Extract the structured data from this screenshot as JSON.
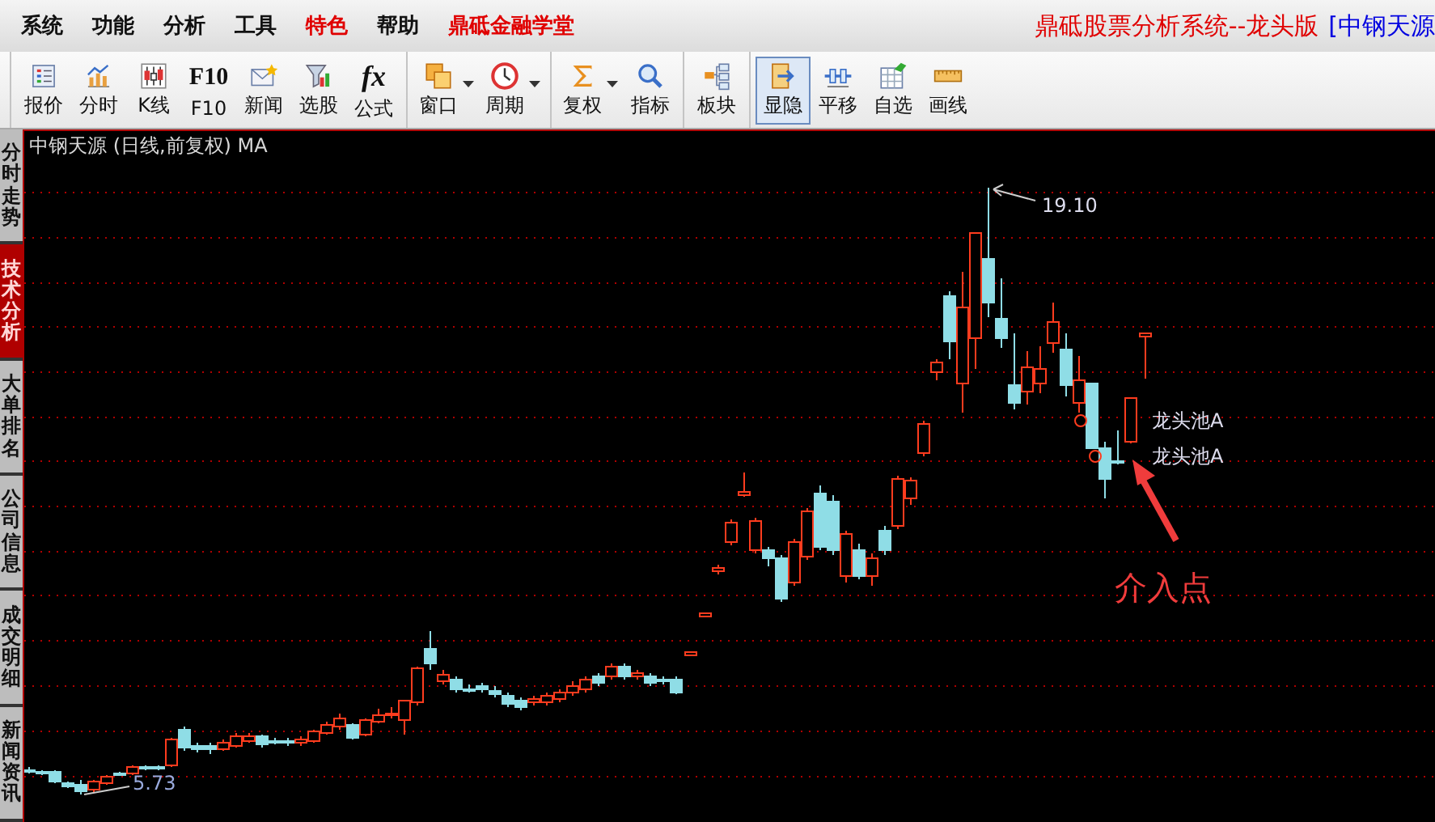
{
  "menu": [
    {
      "label": "系统",
      "highlight": false
    },
    {
      "label": "功能",
      "highlight": false
    },
    {
      "label": "分析",
      "highlight": false
    },
    {
      "label": "工具",
      "highlight": false
    },
    {
      "label": "特色",
      "highlight": true
    },
    {
      "label": "帮助",
      "highlight": false
    },
    {
      "label": "鼎砥金融学堂",
      "highlight": true
    }
  ],
  "app_title": "鼎砥股票分析系统--龙头版",
  "stock_name": "[中钢天源",
  "toolbar": {
    "groups": [
      [
        {
          "label": "报价",
          "dropdown": false,
          "selected": false
        },
        {
          "label": "分时",
          "dropdown": false,
          "selected": false
        },
        {
          "label": "K线",
          "dropdown": false,
          "selected": false
        },
        {
          "label": "F10",
          "icon_text": "F10",
          "dropdown": false,
          "selected": false
        },
        {
          "label": "新闻",
          "dropdown": false,
          "selected": false
        },
        {
          "label": "选股",
          "dropdown": false,
          "selected": false
        },
        {
          "label": "公式",
          "icon_text": "fx",
          "dropdown": false,
          "selected": false
        }
      ],
      [
        {
          "label": "窗口",
          "dropdown": true,
          "selected": false
        },
        {
          "label": "周期",
          "dropdown": true,
          "selected": false
        }
      ],
      [
        {
          "label": "复权",
          "dropdown": true,
          "selected": false
        },
        {
          "label": "指标",
          "dropdown": false,
          "selected": false
        }
      ],
      [
        {
          "label": "板块",
          "dropdown": false,
          "selected": false
        }
      ],
      [
        {
          "label": "显隐",
          "dropdown": false,
          "selected": true
        },
        {
          "label": "平移",
          "dropdown": false,
          "selected": false
        },
        {
          "label": "自选",
          "dropdown": false,
          "selected": false
        },
        {
          "label": "画线",
          "dropdown": false,
          "selected": false
        }
      ]
    ]
  },
  "side_tabs": [
    {
      "label": "分时走势",
      "selected": false
    },
    {
      "label": "技术分析",
      "selected": true
    },
    {
      "label": "大单排名",
      "selected": false
    },
    {
      "label": "公司信息",
      "selected": false
    },
    {
      "label": "成交明细",
      "selected": false
    },
    {
      "label": "新闻资讯",
      "selected": false
    }
  ],
  "chart": {
    "title": "中钢天源 (日线,前复权) MA",
    "high_label": "19.10",
    "low_label": "5.73",
    "signals": [
      {
        "label": "龙头池A"
      },
      {
        "label": "龙头池A"
      }
    ],
    "annotation": "介入点"
  }
}
